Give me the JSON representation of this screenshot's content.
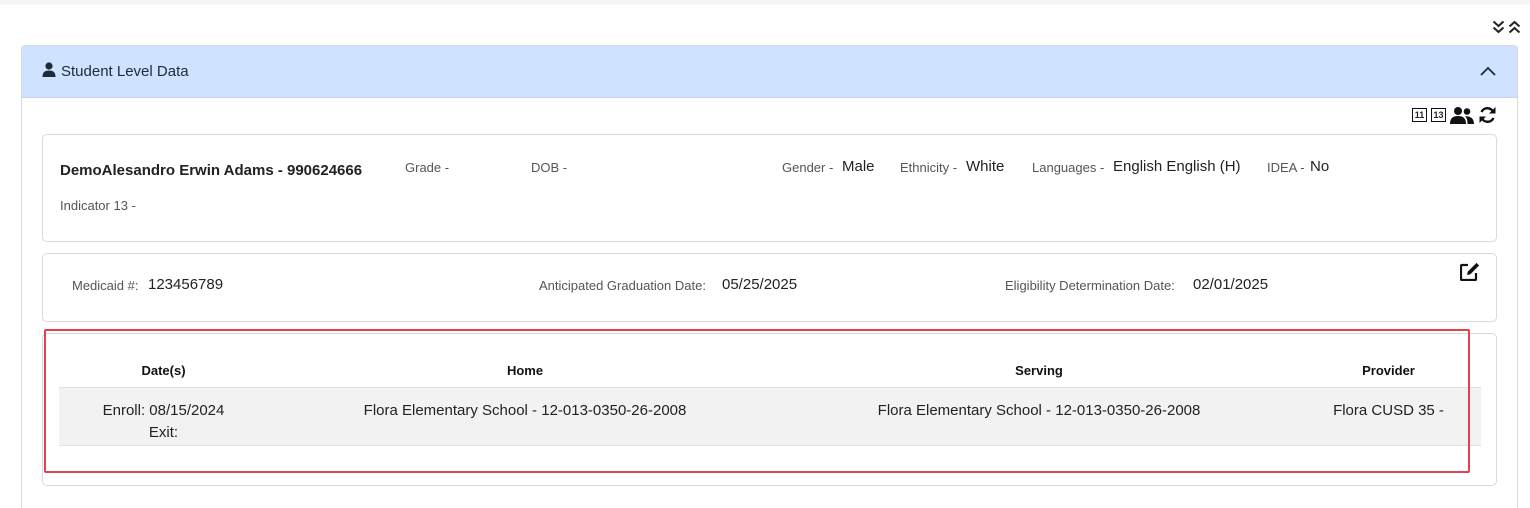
{
  "section": {
    "title": "Student Level Data",
    "icons": {
      "section_icon": "user-icon",
      "collapse_icon": "chevron-up-icon",
      "expand_all": "double-chevron-down-icon",
      "collapse_all": "double-chevron-up-icon"
    }
  },
  "tools": {
    "indicator_11": "11",
    "indicator_13": "13",
    "icons": [
      "users-icon",
      "refresh-icon"
    ]
  },
  "student": {
    "name": "DemoAlesandro Erwin Adams - 990624666",
    "grade_label": "Grade -",
    "grade_value": "",
    "dob_label": "DOB -",
    "dob_value": "",
    "gender_label": "Gender -",
    "gender_value": "Male",
    "ethnicity_label": "Ethnicity -",
    "ethnicity_value": "White",
    "languages_label": "Languages -",
    "languages_value": "English English (H)",
    "idea_label": "IDEA -",
    "idea_value": "No",
    "indicator13_label": "Indicator 13 -",
    "indicator13_value": ""
  },
  "details": {
    "medicaid_label": "Medicaid #:",
    "medicaid_value": "123456789",
    "grad_label": "Anticipated Graduation Date:",
    "grad_value": "05/25/2025",
    "elig_label": "Eligibility Determination Date:",
    "elig_value": "02/01/2025",
    "edit_icon": "edit-icon"
  },
  "enrollment": {
    "headers": [
      "Date(s)",
      "Home",
      "Serving",
      "Provider"
    ],
    "rows": [
      {
        "enroll": "Enroll: 08/15/2024",
        "exit": "Exit:",
        "home": "Flora Elementary School - 12-013-0350-26-2008",
        "serving": "Flora Elementary School - 12-013-0350-26-2008",
        "provider": "Flora CUSD 35 -"
      }
    ]
  },
  "colors": {
    "header_bg": "#cfe2ff",
    "highlight": "#e0434d",
    "row_bg": "#f2f2f2"
  }
}
